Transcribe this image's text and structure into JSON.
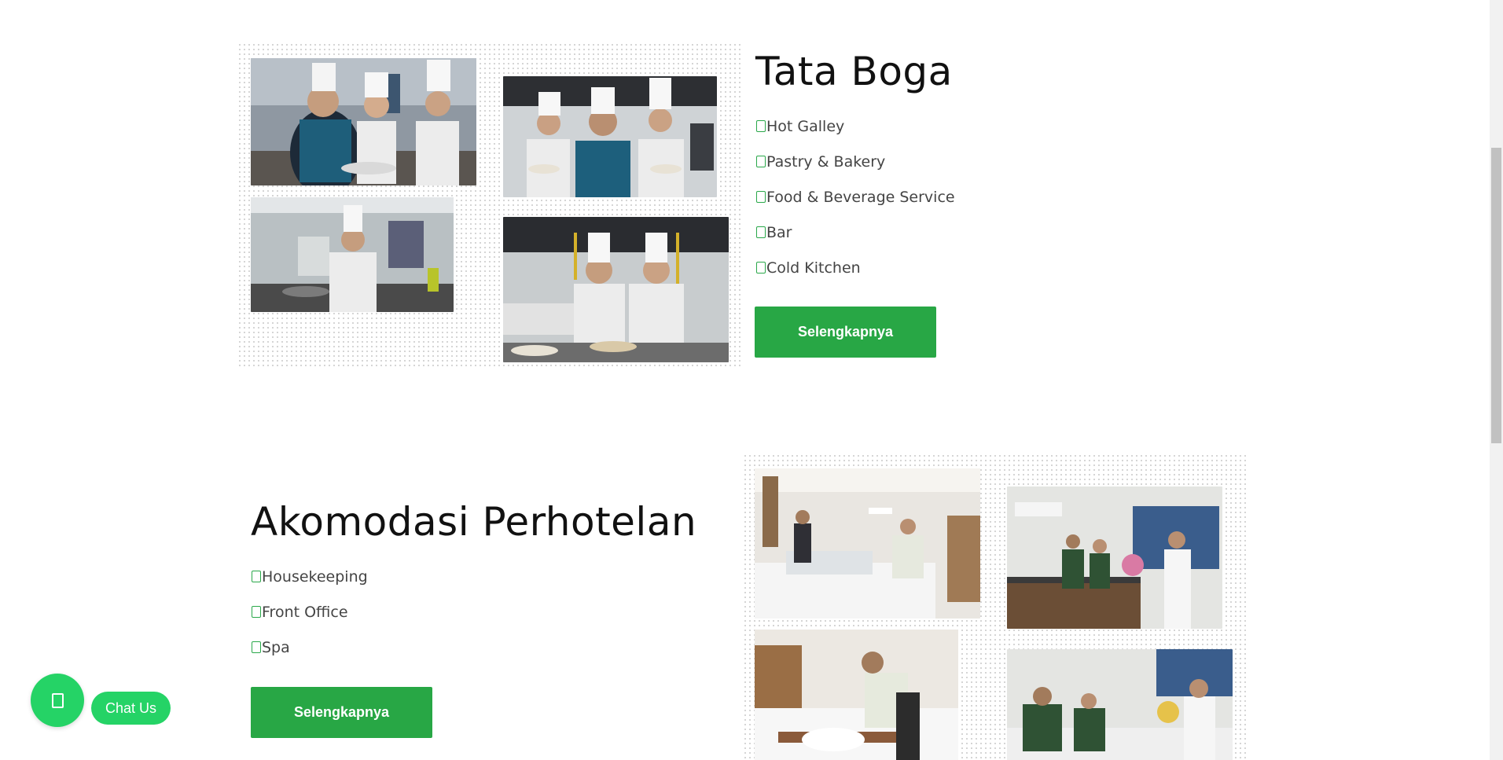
{
  "section_tata_boga": {
    "title": "Tata Boga",
    "items": [
      "Hot Galley",
      "Pastry & Bakery",
      "Food & Beverage Service",
      "Bar",
      "Cold Kitchen"
    ],
    "button_label": "Selengkapnya",
    "photos": [
      "chef-instructor-plating-photo",
      "students-holding-dishes-photo",
      "student-cooking-photo",
      "students-plating-kitchen-photo"
    ]
  },
  "section_akomodasi": {
    "title": "Akomodasi Perhotelan",
    "items": [
      "Housekeeping",
      "Front Office",
      "Spa"
    ],
    "button_label": "Selengkapnya",
    "photos": [
      "bed-making-room-photo",
      "front-desk-greeting-photo",
      "towel-folding-bed-photo",
      "reception-desk-phone-photo"
    ]
  },
  "chat": {
    "label": "Chat Us",
    "icon": "whatsapp-icon"
  },
  "colors": {
    "accent_green": "#28a745",
    "chat_green": "#25d366"
  }
}
